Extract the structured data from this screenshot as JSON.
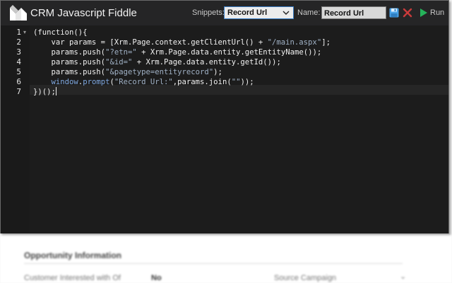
{
  "app": {
    "title": "CRM Javascript Fiddle",
    "accent_color": "#3c7fc7"
  },
  "toolbar": {
    "snippets_label": "Snippets:",
    "snippets_selected": "Record Url",
    "name_label": "Name:",
    "name_value": "Record Url",
    "save_icon": "floppy-disk-icon",
    "close_icon": "close-x-icon",
    "run_icon": "play-triangle-icon",
    "run_label": "Run",
    "save_color": "#4aa3e8",
    "close_color": "#c93b3b",
    "run_color": "#25b35a"
  },
  "editor": {
    "line_numbers": [
      "1",
      "2",
      "3",
      "4",
      "5",
      "6",
      "7"
    ],
    "fold_marker": "▾",
    "lines": [
      "(function(){",
      "    var params = [Xrm.Page.context.getClientUrl() + \"/main.aspx\"];",
      "    params.push(\"?etn=\" + Xrm.Page.data.entity.getEntityName());",
      "    params.push(\"&id=\" + Xrm.Page.data.entity.getId());",
      "    params.push(\"&pagetype=entityrecord\");",
      "    window.prompt(\"Record Url:\",params.join(\"\"));",
      "})();"
    ],
    "colors": {
      "text": "#f0f0f0",
      "string": "#9fb0c4",
      "builtin": "#7fa8e0"
    }
  },
  "background_form": {
    "section_title": "Opportunity Information",
    "field_label": "Customer Interested with Of",
    "field_value": "No",
    "field2_label": "Source Campaign"
  }
}
